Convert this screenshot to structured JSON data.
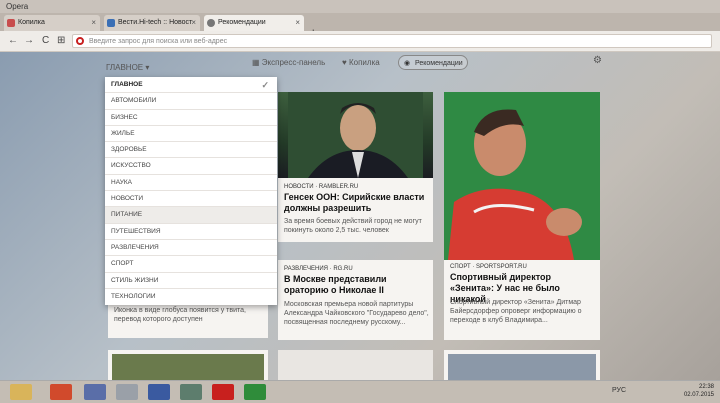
{
  "window": {
    "title": "Opera"
  },
  "tabs": [
    {
      "label": "Копилка",
      "color": "#c84d4d"
    },
    {
      "label": "Вести.Hi-tech :: Новост",
      "color": "#3a6fb5"
    },
    {
      "label": "Рекомендации",
      "color": "#777777",
      "active": true
    }
  ],
  "newtab": "+",
  "address": {
    "placeholder": "Введите запрос для поиска или веб-адрес"
  },
  "nav": {
    "back": "←",
    "forward": "→",
    "reload": "C",
    "grid": "⊞"
  },
  "topnav": {
    "main": "ГЛАВНОЕ ▾",
    "express": "Экспресс-панель",
    "piggy": "Копилка",
    "recommend": "Рекомендации"
  },
  "dropdown": {
    "items": [
      {
        "label": "ГЛАВНОЕ",
        "selected": true
      },
      {
        "label": "АВТОМОБИЛИ"
      },
      {
        "label": "БИЗНЕС"
      },
      {
        "label": "ЖИЛЬЕ"
      },
      {
        "label": "ЗДОРОВЬЕ"
      },
      {
        "label": "ИСКУССТВО"
      },
      {
        "label": "НАУКА"
      },
      {
        "label": "НОВОСТИ"
      },
      {
        "label": "ПИТАНИЕ",
        "hover": true
      },
      {
        "label": "ПУТЕШЕСТВИЯ"
      },
      {
        "label": "РАЗВЛЕЧЕНИЯ"
      },
      {
        "label": "СПОРТ"
      },
      {
        "label": "СТИЛЬ ЖИЗНИ"
      },
      {
        "label": "ТЕХНОЛОГИИ"
      }
    ],
    "check": "✓"
  },
  "cards": {
    "card1": {
      "meta": "НОВОСТИ · RAMBLER.RU",
      "title": "Генсек ООН: Сирийские власти должны разрешить",
      "text": "За время боевых действий город не могут покинуть около 2,5 тыс. человек"
    },
    "card2": {
      "meta": "РАЗВЛЕЧЕНИЯ · RG.RU",
      "title": "В Москве представили ораторию о Николае II",
      "text": "Московская премьера новой партитуры Александра Чайковского \"Государево дело\", посвященная последнему русскому..."
    },
    "card3": {
      "meta": "СПОРТ · SPORTSPORT.RU",
      "title": "Спортивный директор «Зенита»: У нас не было никакой",
      "text": "Спортивный директор «Зенита» Дитмар Байерсдорфер опроверг информацию о переходе в клуб Владимира..."
    },
    "card4": {
      "text": "Иконка в виде глобуса появится у твита, перевод которого доступен"
    }
  },
  "taskbar": {
    "lang": "РУС",
    "time": "22:38",
    "date": "02.07.2015"
  }
}
